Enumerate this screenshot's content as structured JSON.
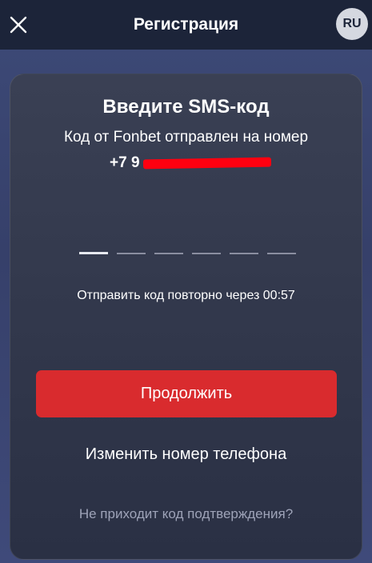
{
  "header": {
    "title": "Регистрация",
    "close_icon": "close-icon",
    "language": "RU"
  },
  "card": {
    "title": "Введите SMS-код",
    "subtitle": "Код от Fonbet отправлен на номер",
    "phone_visible": "+7 9",
    "code_length": 6,
    "active_slot": 1,
    "resend_text": "Отправить код повторно через 00:57",
    "continue_label": "Продолжить",
    "change_phone_label": "Изменить номер телефона",
    "no_code_label": "Не приходит код подтверждения?"
  },
  "colors": {
    "header_bg": "#1c2439",
    "accent_red": "#d92b2e",
    "redaction": "#ff0010",
    "muted_text": "#9ea3b8"
  }
}
